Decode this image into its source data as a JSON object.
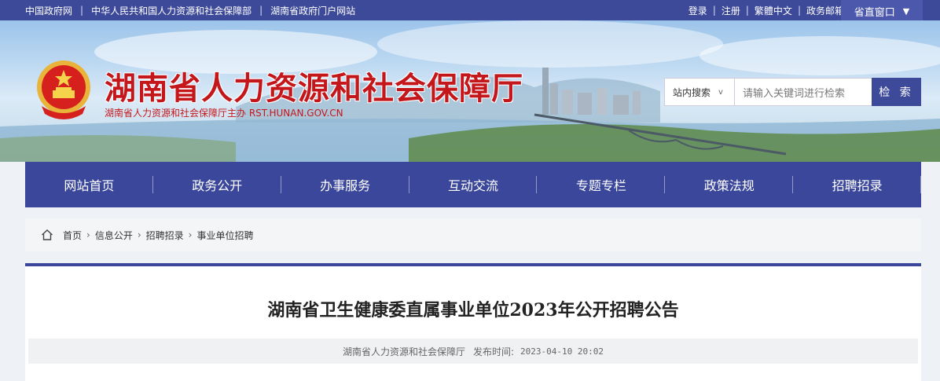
{
  "topbar": {
    "links": [
      "中国政府网",
      "中华人民共和国人力资源和社会保障部",
      "湖南省政府门户网站"
    ],
    "right_links": [
      "登录",
      "注册",
      "繁體中文",
      "政务邮箱"
    ],
    "province_window": "省直窗口"
  },
  "header": {
    "title": "湖南省人力资源和社会保障厅",
    "subtitle": "湖南省人力资源和社会保障厅主办  RST.HUNAN.GOV.CN"
  },
  "search": {
    "scope": "站内搜索",
    "placeholder": "请输入关键词进行检索",
    "button": "检 索"
  },
  "nav": [
    "网站首页",
    "政务公开",
    "办事服务",
    "互动交流",
    "专题专栏",
    "政策法规",
    "招聘招录"
  ],
  "breadcrumb": [
    "首页",
    "信息公开",
    "招聘招录",
    "事业单位招聘"
  ],
  "article": {
    "title": "湖南省卫生健康委直属事业单位2023年公开招聘公告",
    "source": "湖南省人力资源和社会保障厅",
    "time_label": "发布时间:",
    "time": "2023-04-10 20:02"
  },
  "colors": {
    "primary": "#3b479a",
    "title_red": "#c4171c"
  }
}
